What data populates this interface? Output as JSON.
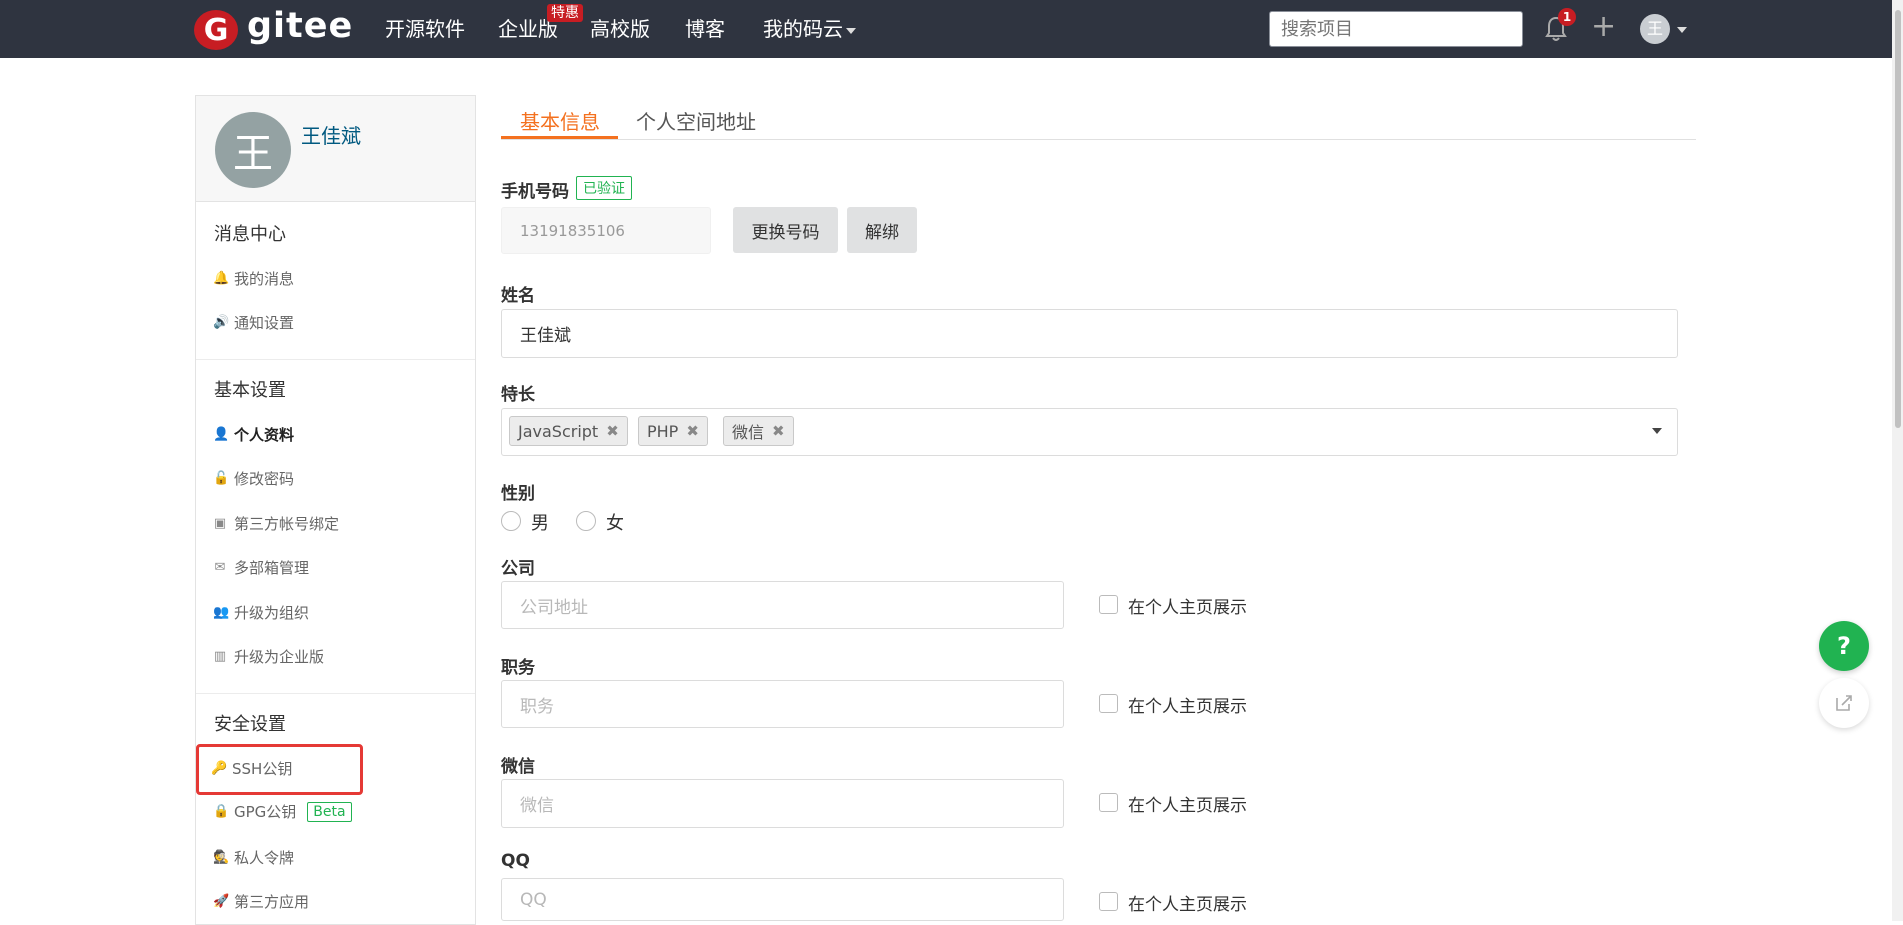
{
  "navbar": {
    "brand": "gitee",
    "nav_items": [
      "开源软件",
      "企业版",
      "高校版",
      "博客",
      "我的码云"
    ],
    "hot_badge": "特惠",
    "search_placeholder": "搜索项目",
    "notification_count": "1",
    "plus": "+",
    "avatar_letter": "王"
  },
  "sidebar": {
    "avatar_letter": "王",
    "username": "王佳斌",
    "groups": [
      {
        "title": "消息中心",
        "items": [
          {
            "label": "我的消息",
            "icon": "bell-icon"
          },
          {
            "label": "通知设置",
            "icon": "volume-icon"
          }
        ]
      },
      {
        "title": "基本设置",
        "items": [
          {
            "label": "个人资料",
            "icon": "user-icon"
          },
          {
            "label": "修改密码",
            "icon": "unlock-icon"
          },
          {
            "label": "第三方帐号绑定",
            "icon": "contact-card-icon"
          },
          {
            "label": "多部箱管理",
            "icon": "envelope-icon"
          },
          {
            "label": "升级为组织",
            "icon": "users-icon"
          },
          {
            "label": "升级为企业版",
            "icon": "building-icon"
          }
        ]
      },
      {
        "title": "安全设置",
        "items": [
          {
            "label": "SSH公钥",
            "icon": "key-icon"
          },
          {
            "label": "GPG公钥",
            "icon": "lock-icon",
            "badge": "Beta"
          },
          {
            "label": "私人令牌",
            "icon": "user-secret-icon"
          },
          {
            "label": "第三方应用",
            "icon": "rocket-icon"
          }
        ]
      }
    ]
  },
  "tabs": [
    "基本信息",
    "个人空间地址"
  ],
  "form": {
    "phone_label": "手机号码",
    "phone_verified": "已验证",
    "phone_value": "13191835106",
    "change_phone": "更换号码",
    "unbind": "解绑",
    "name_label": "姓名",
    "name_value": "王佳斌",
    "skills_label": "特长",
    "skills": [
      "JavaScript",
      "PHP",
      "微信"
    ],
    "tag_remove": "✖",
    "gender_label": "性别",
    "gender_options": [
      "男",
      "女"
    ],
    "company_label": "公司",
    "company_placeholder": "公司地址",
    "position_label": "职务",
    "position_placeholder": "职务",
    "wechat_label": "微信",
    "wechat_placeholder": "微信",
    "qq_label": "QQ",
    "qq_placeholder": "QQ",
    "show_on_homepage": "在个人主页展示"
  },
  "floating": {
    "help": "?",
    "share_icon": "external-edit-icon"
  },
  "colors": {
    "nav_bg": "#2f3440",
    "accent": "#f4711f",
    "brand_red": "#c71d23",
    "green": "#21b351",
    "highlight": "#e53935"
  }
}
